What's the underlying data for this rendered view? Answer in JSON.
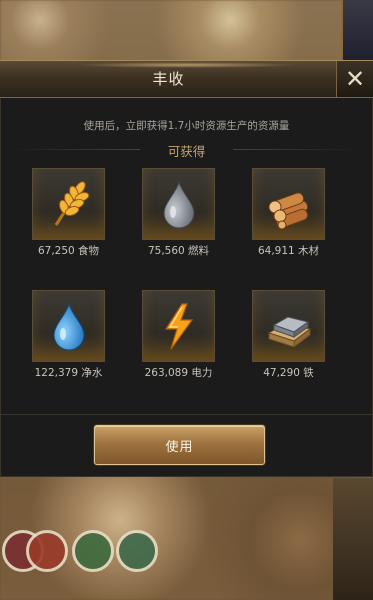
{
  "dialog": {
    "title": "丰收",
    "close_icon": "close-icon",
    "description": "使用后，立即获得1.7小时资源生产的资源量",
    "subtitle": "可获得",
    "use_button_label": "使用"
  },
  "resources": [
    {
      "icon": "wheat-icon",
      "text": "67,250 食物"
    },
    {
      "icon": "fuel-drop-icon",
      "text": "75,560 燃料"
    },
    {
      "icon": "wood-logs-icon",
      "text": "64,911 木材"
    },
    {
      "icon": "water-drop-icon",
      "text": "122,379 净水"
    },
    {
      "icon": "lightning-icon",
      "text": "263,089 电力"
    },
    {
      "icon": "iron-ingot-icon",
      "text": "47,290 铁"
    }
  ],
  "colors": {
    "accent_gold": "#c7a36c",
    "panel_bg": "#1b1b1b",
    "button_gold": "#9f7340"
  }
}
